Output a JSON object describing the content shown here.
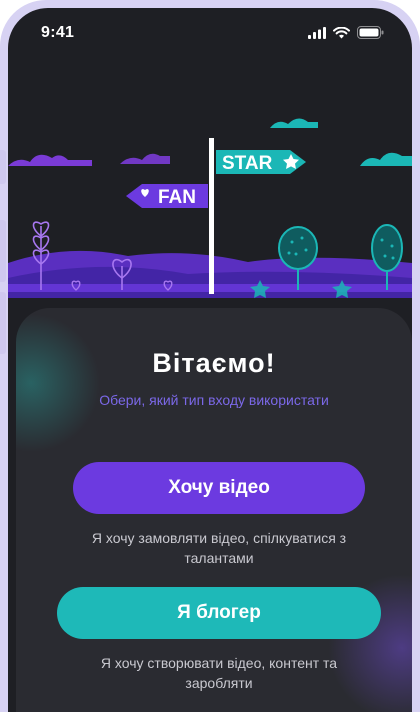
{
  "status_bar": {
    "time": "9:41"
  },
  "hero": {
    "fan_sign": "FAN",
    "star_sign": "STAR"
  },
  "welcome": {
    "title": "Вітаємо!",
    "subtitle": "Обери, який тип входу використати"
  },
  "fan_option": {
    "button_label": "Хочу відео",
    "caption": "Я хочу замовляти відео, спілкуватися з талантами"
  },
  "star_option": {
    "button_label": "Я блогер",
    "caption": "Я хочу створювати відео, контент та заробляти"
  },
  "colors": {
    "background": "#1e1f24",
    "card": "#2a2b31",
    "purple": "#6c3ae0",
    "teal": "#1eb9b8",
    "subtitle": "#7b68e8"
  }
}
